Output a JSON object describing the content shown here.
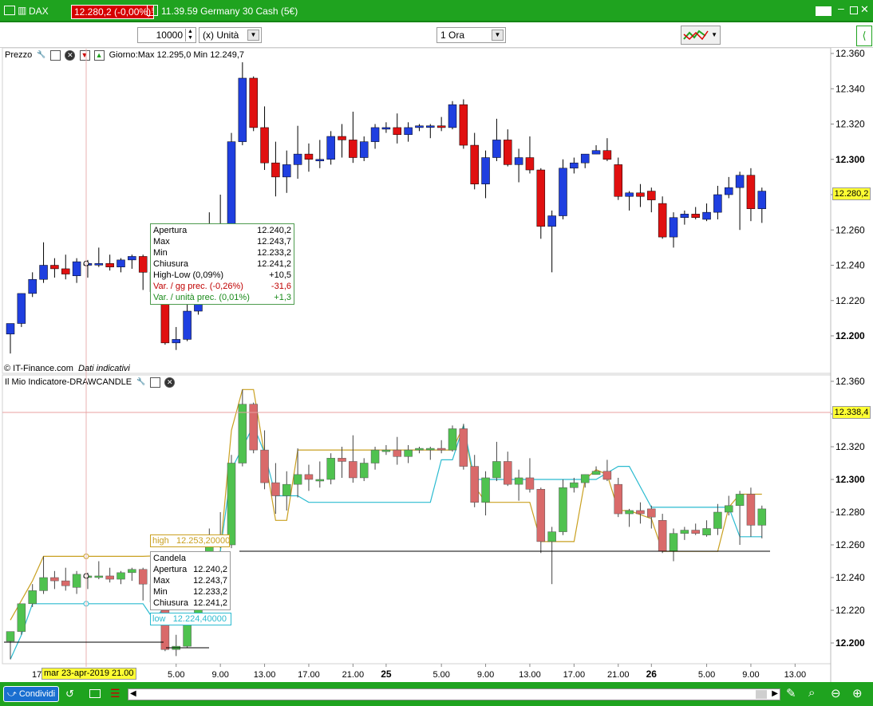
{
  "titlebar": {
    "symbol": "DAX",
    "price_change": "12.280,2 (-0,00%)",
    "time_instrument": "11.39.59 Germany 30 Cash (5€)"
  },
  "toolbar": {
    "quantity_value": "10000",
    "unit_selected": "(x) Unità",
    "timeframe_selected": "1 Ora"
  },
  "price_panel": {
    "title": "Prezzo",
    "day_range": "Giorno:Max 12.295,0 Min 12.249,7",
    "copyright": "© IT-Finance.com",
    "indicative": "Dati indicativi",
    "y_ticks": [
      "12.360",
      "12.340",
      "12.320",
      "12.300",
      "12.280",
      "12.260",
      "12.240",
      "12.220",
      "12.200"
    ],
    "current_price": "12.280,2",
    "tooltip": [
      {
        "label": "Apertura",
        "value": "12.240,2"
      },
      {
        "label": "Max",
        "value": "12.243,7"
      },
      {
        "label": "Min",
        "value": "12.233,2"
      },
      {
        "label": "Chiusura",
        "value": "12.241,2"
      },
      {
        "label": "High-Low (0,09%)",
        "value": "+10,5"
      },
      {
        "label": "Var. / gg prec. (-0,26%)",
        "value": "-31,6"
      },
      {
        "label": "Var. / unità prec. (0,01%)",
        "value": "+1,3"
      }
    ]
  },
  "indicator_panel": {
    "title": "Il Mio Indicatore-DRAWCANDLE",
    "y_ticks": [
      "12.360",
      "12.340",
      "12.320",
      "12.300",
      "12.280",
      "12.260",
      "12.240",
      "12.220",
      "12.200"
    ],
    "cursor_price": "12.338,4",
    "high_label": "high",
    "high_value": "12.253,20000",
    "low_label": "low",
    "low_value": "12.224,40000",
    "tooltip_title": "Candela",
    "tooltip": [
      {
        "label": "Apertura",
        "value": "12.240,2"
      },
      {
        "label": "Max",
        "value": "12.243,7"
      },
      {
        "label": "Min",
        "value": "12.233,2"
      },
      {
        "label": "Chiusura",
        "value": "12.241,2"
      }
    ]
  },
  "x_axis": {
    "cursor_date": "mar 23-apr-2019 21.00",
    "left_label": "17",
    "labels": [
      "5.00",
      "9.00",
      "13.00",
      "17.00",
      "21.00",
      "25",
      "5.00",
      "9.00",
      "13.00",
      "17.00",
      "21.00",
      "26",
      "5.00",
      "9.00",
      "13.00"
    ]
  },
  "bottombar": {
    "share_label": "Condividi"
  },
  "colors": {
    "bull_price": "#1f3fe0",
    "bear_price": "#e01010",
    "bull_indicator": "#4fc24f",
    "bear_indicator": "#d96a6a",
    "high_line": "#c9a020",
    "low_line": "#2bbbd0",
    "highlight": "#ffff33",
    "brand_green": "#1fa31f"
  },
  "candles": [
    {
      "o": 12201,
      "h": 12206,
      "l": 12190,
      "c": 12207
    },
    {
      "o": 12207,
      "h": 12224,
      "l": 12205,
      "c": 12224
    },
    {
      "o": 12224,
      "h": 12236,
      "l": 12222,
      "c": 12232
    },
    {
      "o": 12232,
      "h": 12253,
      "l": 12230,
      "c": 12240
    },
    {
      "o": 12240,
      "h": 12244,
      "l": 12233,
      "c": 12238
    },
    {
      "o": 12238,
      "h": 12246,
      "l": 12232,
      "c": 12235
    },
    {
      "o": 12234,
      "h": 12244,
      "l": 12230,
      "c": 12242
    },
    {
      "o": 12240,
      "h": 12243,
      "l": 12233,
      "c": 12241
    },
    {
      "o": 12241,
      "h": 12250,
      "l": 12239,
      "c": 12241
    },
    {
      "o": 12241,
      "h": 12246,
      "l": 12237,
      "c": 12239
    },
    {
      "o": 12239,
      "h": 12244,
      "l": 12236,
      "c": 12243
    },
    {
      "o": 12243,
      "h": 12246,
      "l": 12238,
      "c": 12245
    },
    {
      "o": 12245,
      "h": 12246,
      "l": 12226,
      "c": 12236
    },
    {
      "o": 12236,
      "h": 12240,
      "l": 12220,
      "c": 12225
    },
    {
      "o": 12220,
      "h": 12224,
      "l": 12195,
      "c": 12196
    },
    {
      "o": 12196,
      "h": 12205,
      "l": 12192,
      "c": 12198
    },
    {
      "o": 12198,
      "h": 12218,
      "l": 12197,
      "c": 12214
    },
    {
      "o": 12214,
      "h": 12232,
      "l": 12212,
      "c": 12228
    },
    {
      "o": 12228,
      "h": 12270,
      "l": 12226,
      "c": 12262
    },
    {
      "o": 12262,
      "h": 12280,
      "l": 12258,
      "c": 12260
    },
    {
      "o": 12260,
      "h": 12315,
      "l": 12258,
      "c": 12310
    },
    {
      "o": 12310,
      "h": 12355,
      "l": 12308,
      "c": 12346
    },
    {
      "o": 12346,
      "h": 12347,
      "l": 12316,
      "c": 12318
    },
    {
      "o": 12318,
      "h": 12330,
      "l": 12294,
      "c": 12298
    },
    {
      "o": 12298,
      "h": 12310,
      "l": 12279,
      "c": 12290
    },
    {
      "o": 12290,
      "h": 12305,
      "l": 12281,
      "c": 12297
    },
    {
      "o": 12297,
      "h": 12319,
      "l": 12289,
      "c": 12303
    },
    {
      "o": 12303,
      "h": 12309,
      "l": 12293,
      "c": 12300
    },
    {
      "o": 12300,
      "h": 12311,
      "l": 12295,
      "c": 12300
    },
    {
      "o": 12300,
      "h": 12316,
      "l": 12297,
      "c": 12313
    },
    {
      "o": 12313,
      "h": 12320,
      "l": 12301,
      "c": 12311
    },
    {
      "o": 12311,
      "h": 12327,
      "l": 12298,
      "c": 12301
    },
    {
      "o": 12301,
      "h": 12313,
      "l": 12299,
      "c": 12310
    },
    {
      "o": 12310,
      "h": 12320,
      "l": 12306,
      "c": 12318
    },
    {
      "o": 12318,
      "h": 12321,
      "l": 12315,
      "c": 12318
    },
    {
      "o": 12318,
      "h": 12326,
      "l": 12309,
      "c": 12314
    },
    {
      "o": 12314,
      "h": 12321,
      "l": 12310,
      "c": 12318
    },
    {
      "o": 12318,
      "h": 12320,
      "l": 12316,
      "c": 12319
    },
    {
      "o": 12319,
      "h": 12320,
      "l": 12312,
      "c": 12319
    },
    {
      "o": 12319,
      "h": 12324,
      "l": 12316,
      "c": 12318
    },
    {
      "o": 12318,
      "h": 12333,
      "l": 12317,
      "c": 12331
    },
    {
      "o": 12331,
      "h": 12334,
      "l": 12306,
      "c": 12308
    },
    {
      "o": 12308,
      "h": 12315,
      "l": 12283,
      "c": 12286
    },
    {
      "o": 12286,
      "h": 12305,
      "l": 12278,
      "c": 12301
    },
    {
      "o": 12301,
      "h": 12323,
      "l": 12299,
      "c": 12311
    },
    {
      "o": 12311,
      "h": 12317,
      "l": 12296,
      "c": 12297
    },
    {
      "o": 12297,
      "h": 12306,
      "l": 12287,
      "c": 12301
    },
    {
      "o": 12301,
      "h": 12313,
      "l": 12292,
      "c": 12294
    },
    {
      "o": 12294,
      "h": 12295,
      "l": 12255,
      "c": 12262
    },
    {
      "o": 12262,
      "h": 12271,
      "l": 12236,
      "c": 12268
    },
    {
      "o": 12268,
      "h": 12300,
      "l": 12266,
      "c": 12295
    },
    {
      "o": 12295,
      "h": 12301,
      "l": 12292,
      "c": 12298
    },
    {
      "o": 12298,
      "h": 12303,
      "l": 12295,
      "c": 12303
    },
    {
      "o": 12303,
      "h": 12308,
      "l": 12303,
      "c": 12305
    },
    {
      "o": 12305,
      "h": 12312,
      "l": 12299,
      "c": 12300
    },
    {
      "o": 12297,
      "h": 12301,
      "l": 12277,
      "c": 12279
    },
    {
      "o": 12279,
      "h": 12282,
      "l": 12271,
      "c": 12281
    },
    {
      "o": 12281,
      "h": 12286,
      "l": 12273,
      "c": 12279
    },
    {
      "o": 12282,
      "h": 12284,
      "l": 12270,
      "c": 12277
    },
    {
      "o": 12275,
      "h": 12279,
      "l": 12255,
      "c": 12256
    },
    {
      "o": 12256,
      "h": 12270,
      "l": 12250,
      "c": 12267
    },
    {
      "o": 12267,
      "h": 12271,
      "l": 12263,
      "c": 12269
    },
    {
      "o": 12269,
      "h": 12273,
      "l": 12266,
      "c": 12267
    },
    {
      "o": 12266,
      "h": 12275,
      "l": 12265,
      "c": 12270
    },
    {
      "o": 12270,
      "h": 12285,
      "l": 12266,
      "c": 12280
    },
    {
      "o": 12280,
      "h": 12290,
      "l": 12278,
      "c": 12284
    },
    {
      "o": 12284,
      "h": 12293,
      "l": 12260,
      "c": 12291
    },
    {
      "o": 12291,
      "h": 12295,
      "l": 12265,
      "c": 12272
    },
    {
      "o": 12272,
      "h": 12284,
      "l": 12264,
      "c": 12282
    }
  ],
  "high_line_pts": [
    [
      0,
      12214
    ],
    [
      2,
      12238
    ],
    [
      3,
      12253
    ],
    [
      12,
      12253
    ],
    [
      16,
      12254
    ],
    [
      19,
      12256
    ],
    [
      20,
      12330
    ],
    [
      21,
      12355
    ],
    [
      22,
      12355
    ],
    [
      24,
      12275
    ],
    [
      25,
      12275
    ],
    [
      26,
      12318
    ],
    [
      40,
      12318
    ],
    [
      41,
      12333
    ],
    [
      42,
      12296
    ],
    [
      43,
      12286
    ],
    [
      47,
      12286
    ],
    [
      48,
      12262
    ],
    [
      51,
      12262
    ],
    [
      52,
      12300
    ],
    [
      53,
      12306
    ],
    [
      54,
      12303
    ],
    [
      55,
      12281
    ],
    [
      56,
      12281
    ],
    [
      58,
      12276
    ],
    [
      59,
      12256
    ],
    [
      64,
      12256
    ],
    [
      65,
      12283
    ],
    [
      66,
      12291
    ],
    [
      68,
      12291
    ]
  ],
  "low_line_pts": [
    [
      0,
      12190
    ],
    [
      1,
      12205
    ],
    [
      2,
      12224
    ],
    [
      3,
      12224
    ],
    [
      7,
      12224
    ],
    [
      8,
      12224
    ],
    [
      12,
      12224
    ],
    [
      13,
      12214
    ],
    [
      17,
      12248
    ],
    [
      19,
      12256
    ],
    [
      20,
      12306
    ],
    [
      22,
      12333
    ],
    [
      23,
      12316
    ],
    [
      24,
      12290
    ],
    [
      26,
      12290
    ],
    [
      27,
      12286
    ],
    [
      38,
      12286
    ],
    [
      39,
      12312
    ],
    [
      40,
      12312
    ],
    [
      41,
      12333
    ],
    [
      42,
      12300
    ],
    [
      47,
      12300
    ],
    [
      48,
      12300
    ],
    [
      53,
      12300
    ],
    [
      55,
      12308
    ],
    [
      56,
      12308
    ],
    [
      58,
      12283
    ],
    [
      64,
      12283
    ],
    [
      65,
      12283
    ],
    [
      66,
      12265
    ],
    [
      68,
      12265
    ]
  ]
}
